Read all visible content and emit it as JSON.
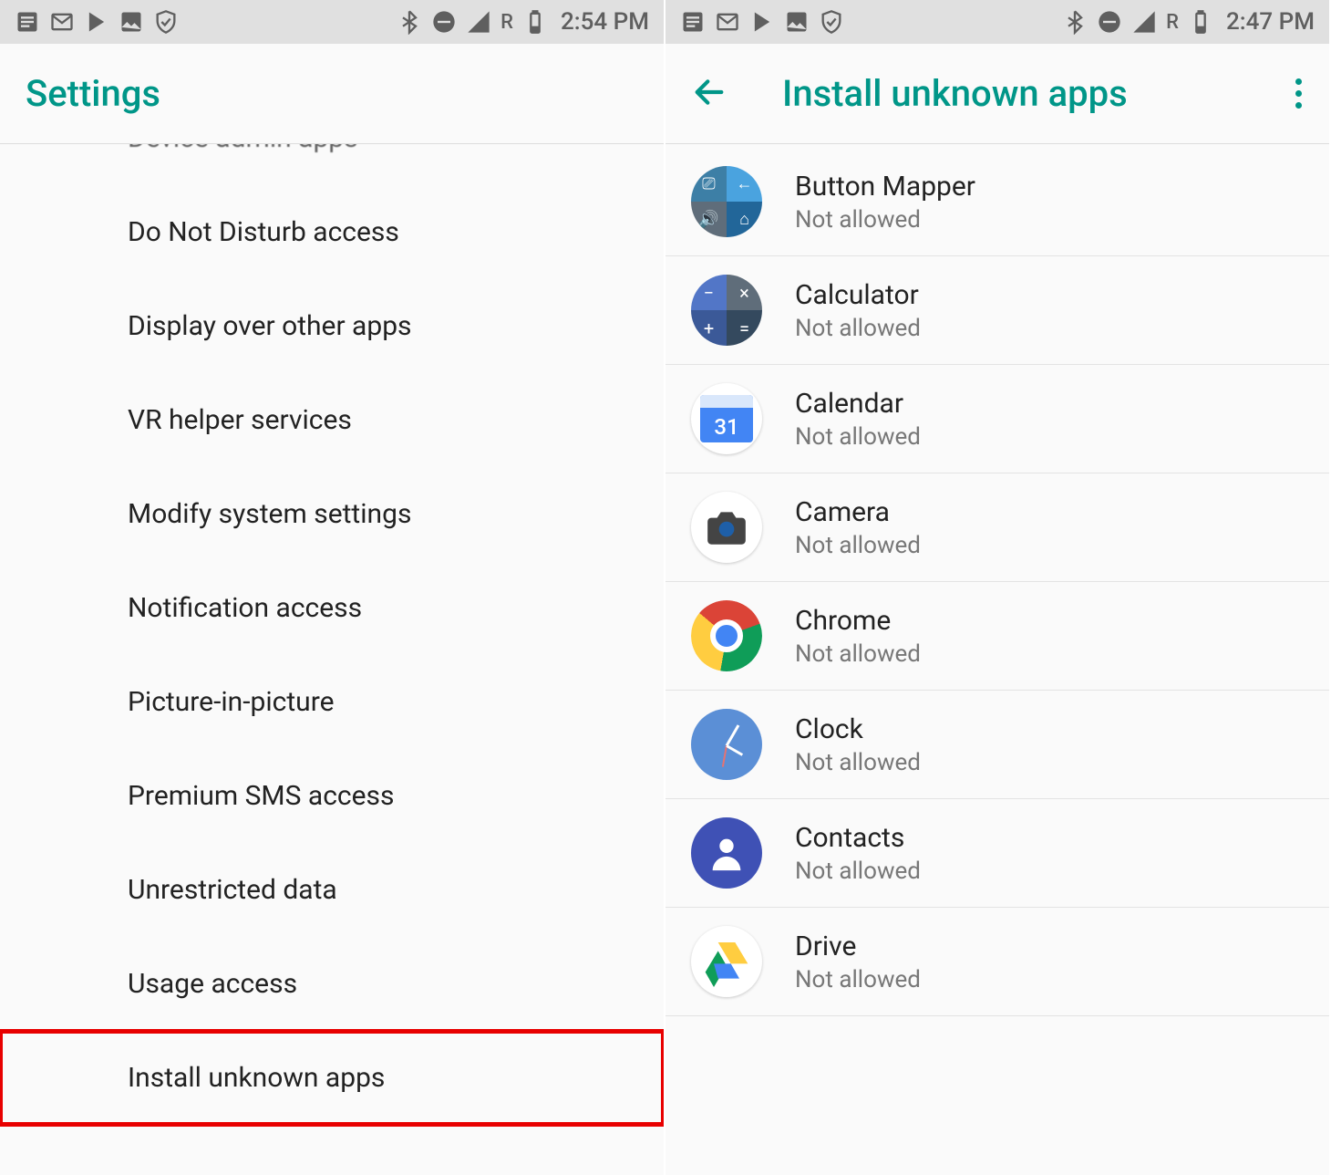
{
  "left": {
    "statusbar": {
      "time": "2:54 PM",
      "network_label": "R"
    },
    "header": {
      "title": "Settings"
    },
    "items": [
      {
        "label": "Device admin apps",
        "cut": true
      },
      {
        "label": "Do Not Disturb access"
      },
      {
        "label": "Display over other apps"
      },
      {
        "label": "VR helper services"
      },
      {
        "label": "Modify system settings"
      },
      {
        "label": "Notification access"
      },
      {
        "label": "Picture-in-picture"
      },
      {
        "label": "Premium SMS access"
      },
      {
        "label": "Unrestricted data"
      },
      {
        "label": "Usage access"
      },
      {
        "label": "Install unknown apps",
        "highlight": true
      }
    ]
  },
  "right": {
    "statusbar": {
      "time": "2:47 PM",
      "network_label": "R"
    },
    "header": {
      "title": "Install unknown apps"
    },
    "apps": [
      {
        "name": "Button Mapper",
        "status": "Not allowed",
        "icon": "btnmapper"
      },
      {
        "name": "Calculator",
        "status": "Not allowed",
        "icon": "calc"
      },
      {
        "name": "Calendar",
        "status": "Not allowed",
        "icon": "calendar",
        "day": "31"
      },
      {
        "name": "Camera",
        "status": "Not allowed",
        "icon": "camera"
      },
      {
        "name": "Chrome",
        "status": "Not allowed",
        "icon": "chrome"
      },
      {
        "name": "Clock",
        "status": "Not allowed",
        "icon": "clock"
      },
      {
        "name": "Contacts",
        "status": "Not allowed",
        "icon": "contacts"
      },
      {
        "name": "Drive",
        "status": "Not allowed",
        "icon": "drive"
      }
    ]
  }
}
